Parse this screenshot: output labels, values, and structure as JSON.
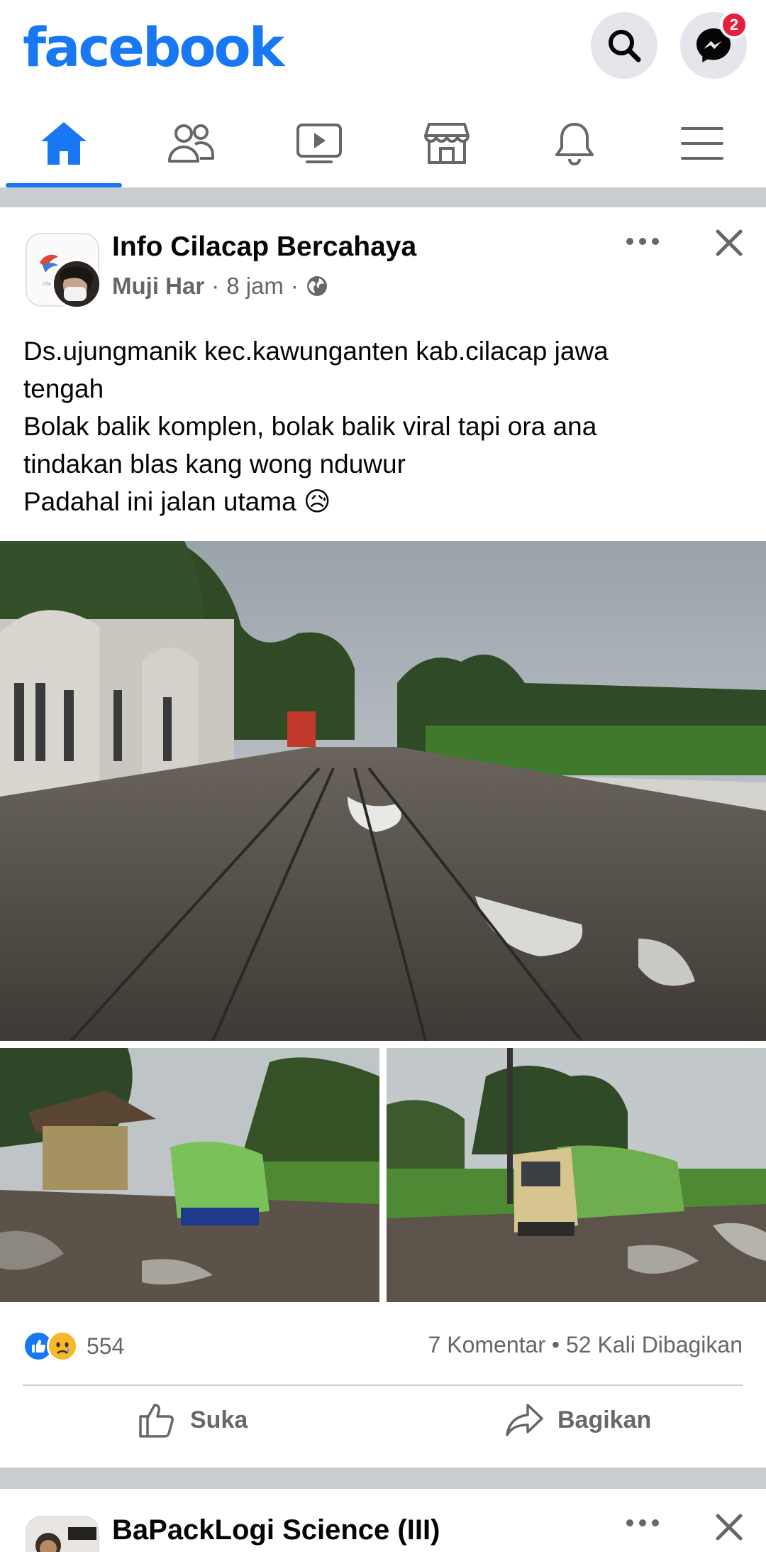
{
  "app": {
    "logo": "facebook"
  },
  "header": {
    "search_icon": "search-icon",
    "messenger_icon": "messenger-icon",
    "messenger_badge": "2",
    "brand_color": "#1877f2"
  },
  "nav": {
    "tabs": [
      {
        "name": "home",
        "icon": "home-icon",
        "active": true
      },
      {
        "name": "friends",
        "icon": "friends-icon",
        "active": false
      },
      {
        "name": "watch",
        "icon": "video-icon",
        "active": false
      },
      {
        "name": "marketplace",
        "icon": "marketplace-icon",
        "active": false
      },
      {
        "name": "notifications",
        "icon": "bell-icon",
        "active": false
      },
      {
        "name": "menu",
        "icon": "menu-icon",
        "active": false
      }
    ]
  },
  "post": {
    "group_name": "Info Cilacap Bercahaya",
    "author": "Muji Har",
    "time": "8 jam",
    "separator": "·",
    "privacy_icon": "globe-icon",
    "text_lines": [
      "Ds.ujungmanik kec.kawunganten kab.cilacap jawa",
      "tengah",
      "Bolak balik komplen, bolak balik viral tapi ora ana",
      "tindakan blas kang wong nduwur",
      "Padahal ini jalan utama 😥"
    ],
    "reaction_count": "554",
    "comments": "7 Komentar",
    "shares": "52 Kali Dibagikan",
    "stats_separator": "•",
    "like_label": "Suka",
    "share_label": "Bagikan"
  },
  "next_post": {
    "group_name": "BaPackLogi Science (III)"
  }
}
